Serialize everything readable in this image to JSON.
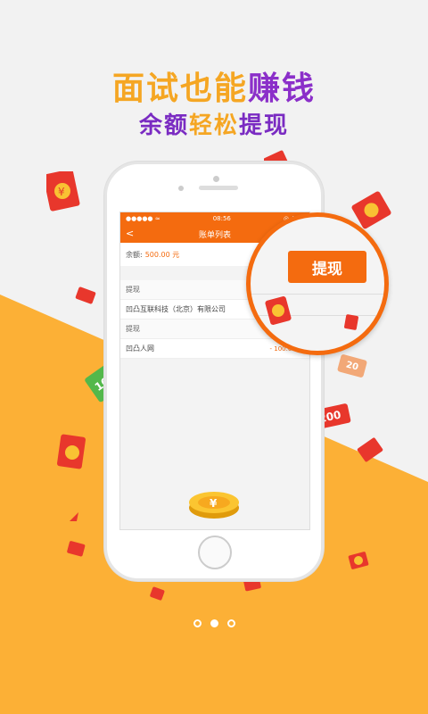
{
  "headline": {
    "part1": "面试也能",
    "part2": "赚钱",
    "sub1": "余额",
    "sub2": "轻松",
    "sub3": "提现"
  },
  "status_bar": {
    "signal": "●●●●● ≈",
    "time": "08:56",
    "right": "◎ ✈ ▬"
  },
  "nav": {
    "back": "<",
    "title": "账单列表"
  },
  "balance": {
    "label": "余额:",
    "amount": "500.00 元"
  },
  "rows": [
    {
      "label": "提现",
      "amount": ""
    },
    {
      "label": "凹凸互联科技（北京）有限公司",
      "amount": ""
    },
    {
      "label": "提现",
      "amount": ""
    },
    {
      "label": "凹凸人网",
      "amount": "- 100.00 元"
    }
  ],
  "magnifier": {
    "button": "提现"
  },
  "coin_symbol": "¥",
  "money_tags": [
    "100",
    "200",
    "20"
  ],
  "pagination": {
    "count": 3,
    "active": 1
  },
  "colors": {
    "accent": "#f46b0f",
    "orange_bg": "#fcb036",
    "purple": "#7a2bc2"
  }
}
